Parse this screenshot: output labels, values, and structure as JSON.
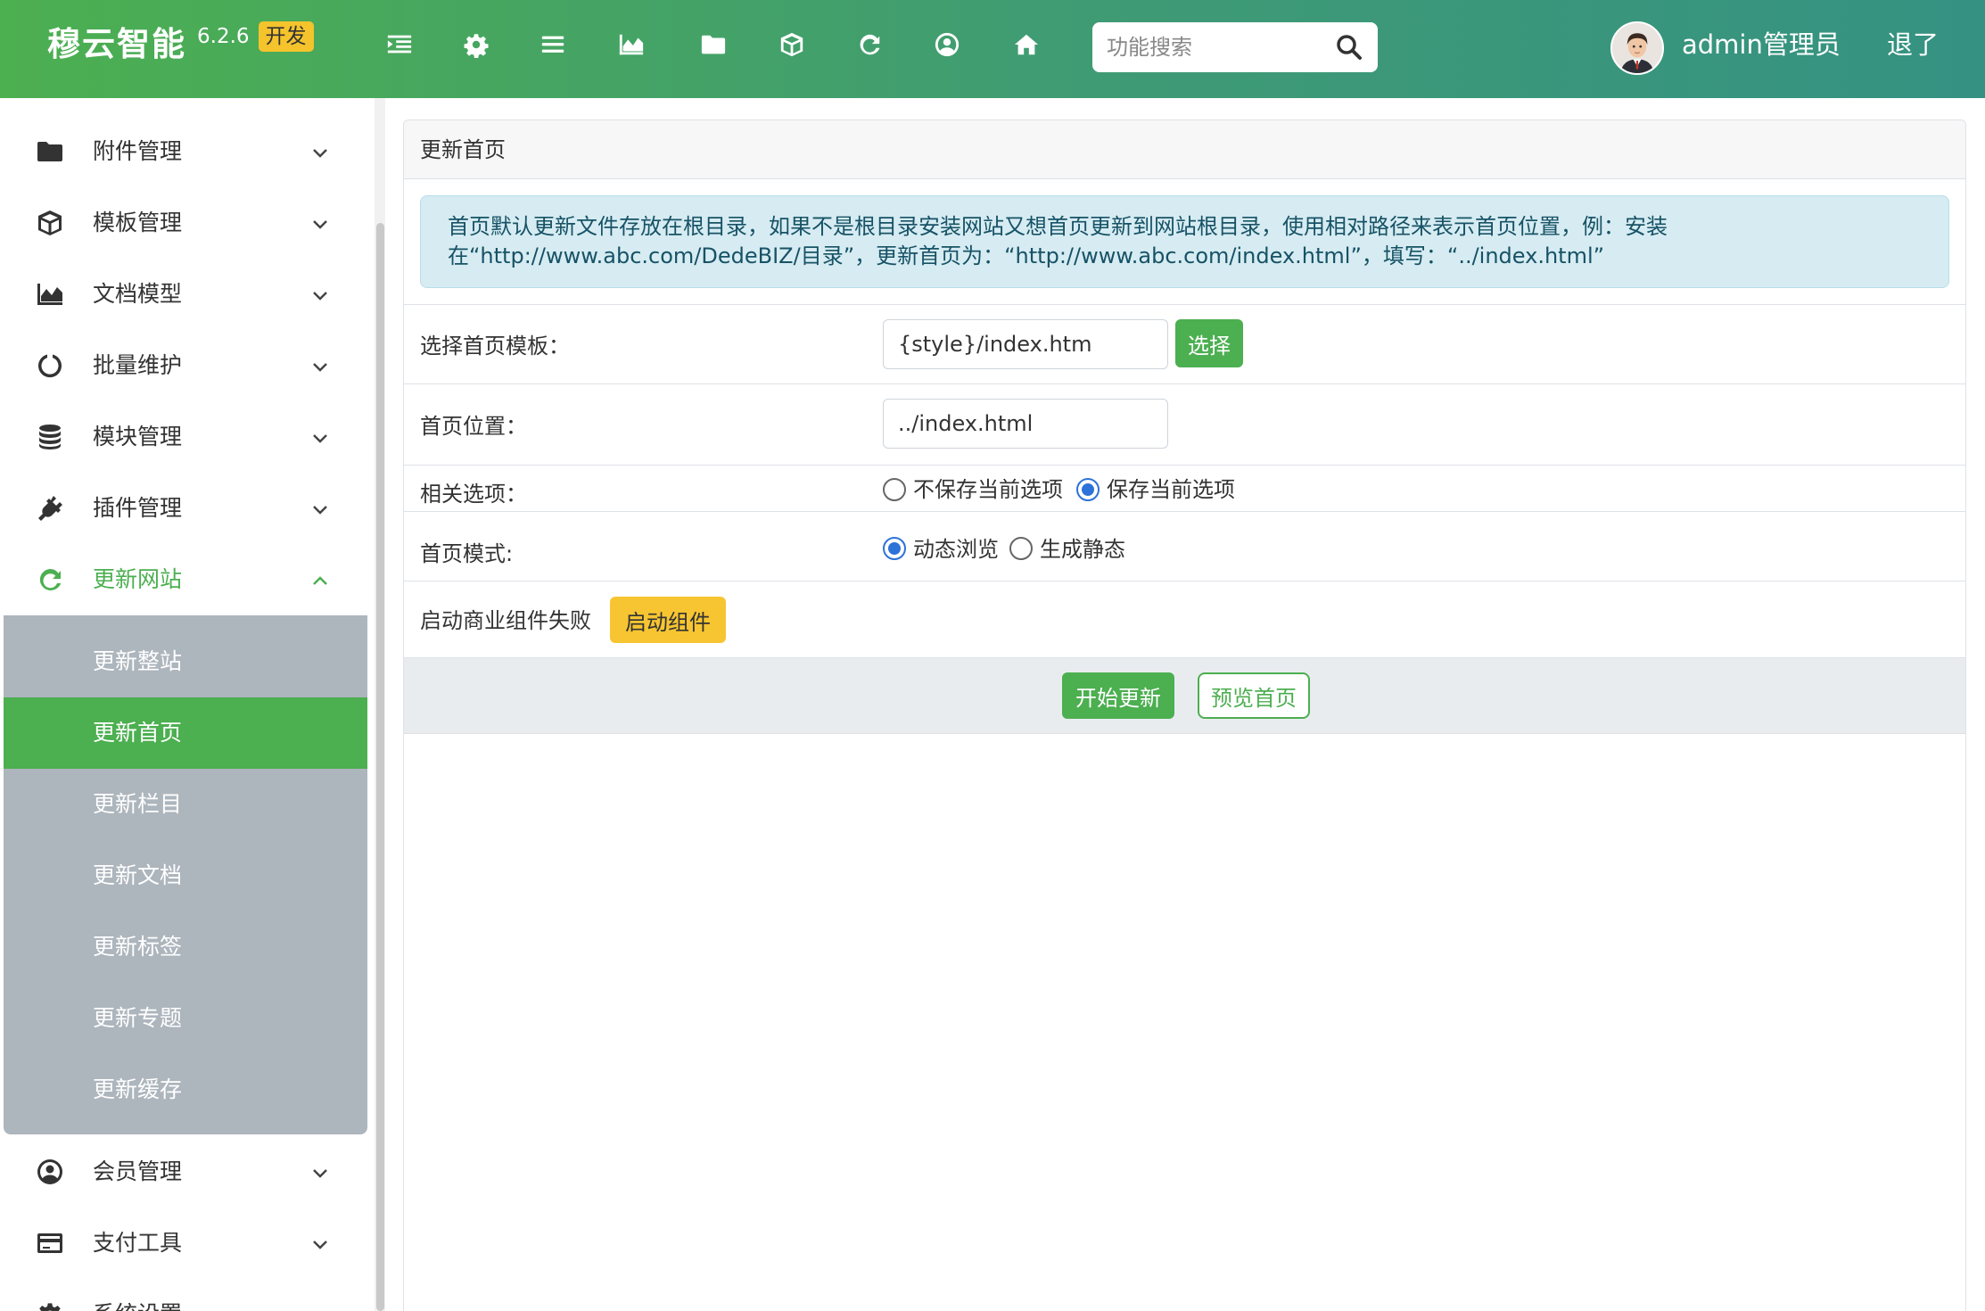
{
  "header": {
    "brand_name": "穆云智能",
    "version": "6.2.6",
    "badge": "开发",
    "search": {
      "placeholder": "功能搜索",
      "value": ""
    },
    "username": "admin管理员",
    "logout_label": "退了",
    "toolbar_icons": [
      "indent-icon",
      "gear-icon",
      "list-icon",
      "area-chart-icon",
      "folder-icon",
      "cube-icon",
      "refresh-icon",
      "user-circle-icon",
      "home-icon"
    ]
  },
  "sidebar": {
    "items": [
      {
        "label": "附件管理",
        "icon": "folder-icon"
      },
      {
        "label": "模板管理",
        "icon": "cube-icon"
      },
      {
        "label": "文档模型",
        "icon": "area-chart-icon"
      },
      {
        "label": "批量维护",
        "icon": "circle-notch-icon"
      },
      {
        "label": "模块管理",
        "icon": "database-icon"
      },
      {
        "label": "插件管理",
        "icon": "plug-icon"
      },
      {
        "label": "更新网站",
        "icon": "refresh-icon",
        "active": true
      },
      {
        "label": "会员管理",
        "icon": "user-circle-icon"
      },
      {
        "label": "支付工具",
        "icon": "credit-card-icon"
      },
      {
        "label": "系统设置",
        "icon": "gear-icon"
      }
    ],
    "submenu": [
      {
        "label": "更新整站"
      },
      {
        "label": "更新首页",
        "active": true
      },
      {
        "label": "更新栏目"
      },
      {
        "label": "更新文档"
      },
      {
        "label": "更新标签"
      },
      {
        "label": "更新专题"
      },
      {
        "label": "更新缓存"
      }
    ]
  },
  "main": {
    "panel_title": "更新首页",
    "alert_text": "首页默认更新文件存放在根目录，如果不是根目录安装网站又想首页更新到网站根目录，使用相对路径来表示首页位置，例：安装在“http://www.abc.com/DedeBIZ/目录”，更新首页为：“http://www.abc.com/index.html”，填写：“../index.html”",
    "template_label": "选择首页模板：",
    "template_value": "{style}/index.htm",
    "select_button": "选择",
    "position_label": "首页位置：",
    "position_value": "../index.html",
    "options_label": "相关选项：",
    "options": [
      {
        "label": "不保存当前选项",
        "checked": false
      },
      {
        "label": "保存当前选项",
        "checked": true
      }
    ],
    "mode_label": "首页模式:",
    "modes": [
      {
        "label": "动态浏览",
        "checked": true
      },
      {
        "label": "生成静态",
        "checked": false
      }
    ],
    "commercial_text": "启动商业组件失败",
    "commercial_button": "启动组件",
    "start_button": "开始更新",
    "preview_button": "预览首页"
  },
  "colors": {
    "primary": "#4caf50",
    "header_gradient_end": "#359282",
    "warning": "#f7c531",
    "alert_bg": "#d6ecf2",
    "submenu_bg": "#adb5bd",
    "radio_checked": "#2d72d9"
  }
}
